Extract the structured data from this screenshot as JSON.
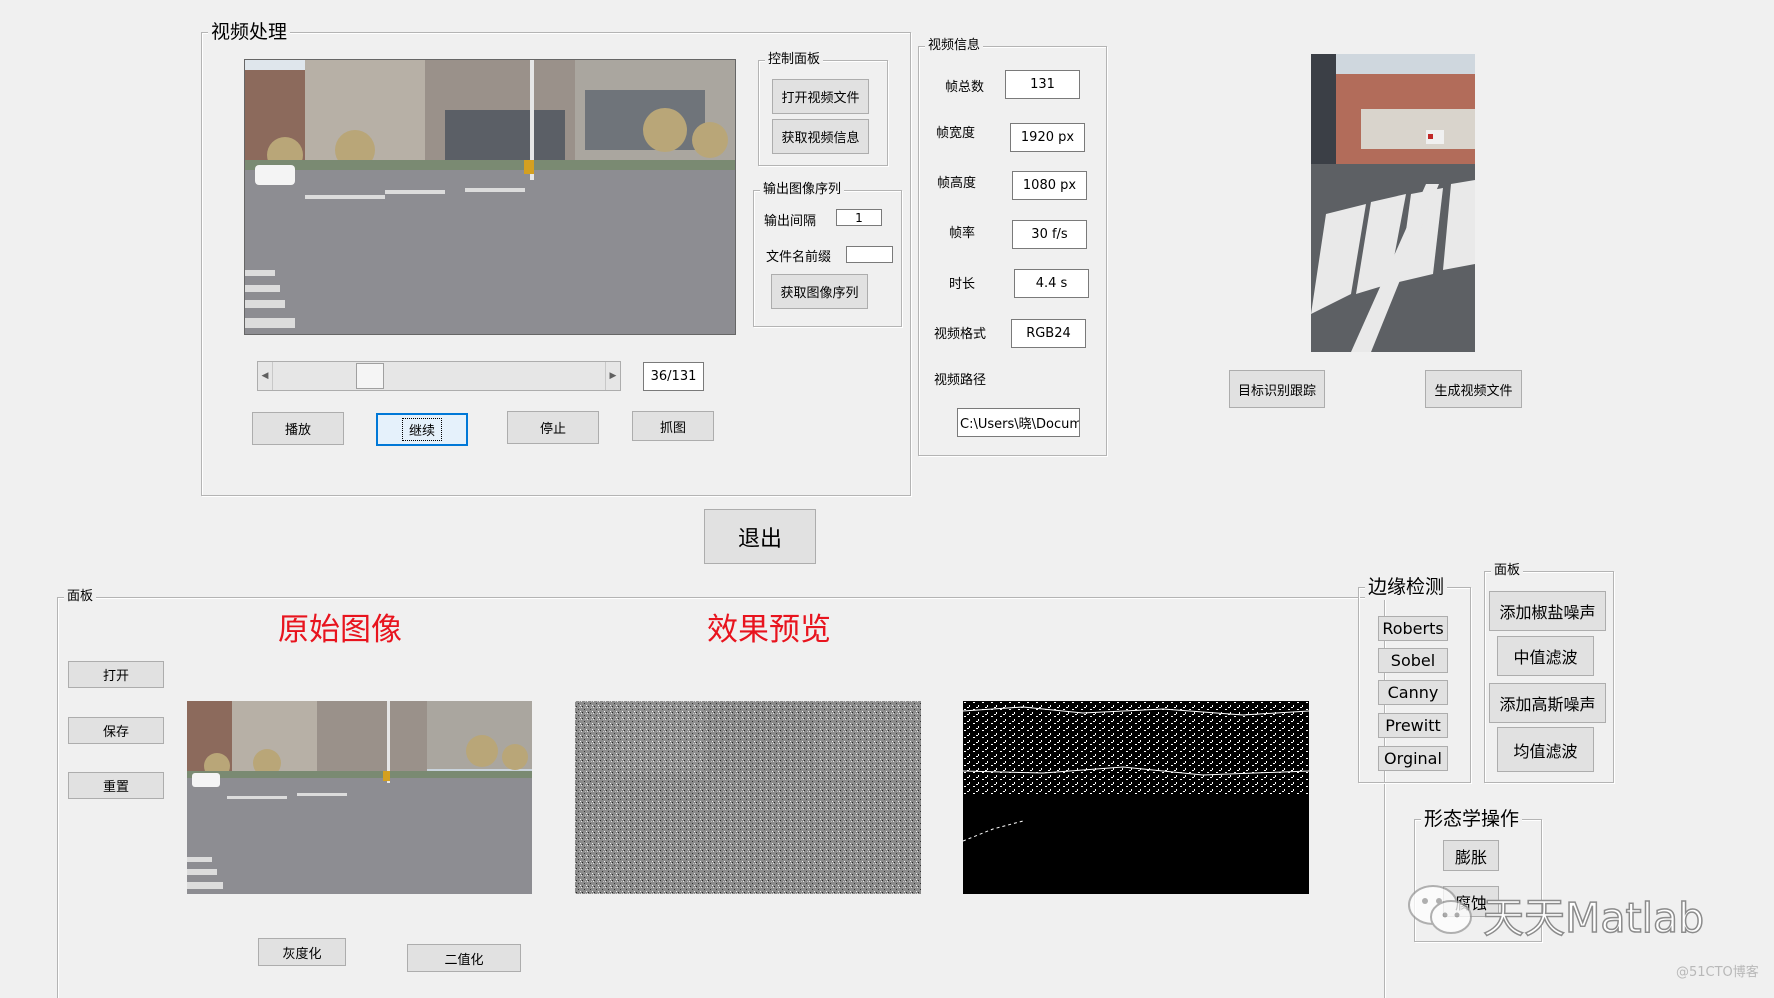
{
  "video_panel": {
    "title": "视频处理",
    "control_panel": {
      "title": "控制面板",
      "open_video_label": "打开视频文件",
      "get_info_label": "获取视频信息"
    },
    "output_sequence": {
      "title": "输出图像序列",
      "interval_label": "输出间隔",
      "interval_value": "1",
      "prefix_label": "文件名前缀",
      "prefix_value": "",
      "get_sequence_label": "获取图像序列"
    },
    "frame_counter": "36/131",
    "slider_fraction": 0.275,
    "buttons": {
      "play": "播放",
      "continue": "继续",
      "stop": "停止",
      "capture": "抓图"
    }
  },
  "video_info": {
    "title": "视频信息",
    "rows": [
      {
        "label": "帧总数",
        "value": "131"
      },
      {
        "label": "帧宽度",
        "value": "1920 px"
      },
      {
        "label": "帧高度",
        "value": "1080 px"
      },
      {
        "label": "帧率",
        "value": "30 f/s"
      },
      {
        "label": "时长",
        "value": "4.4 s"
      },
      {
        "label": "视频格式",
        "value": "RGB24"
      }
    ],
    "path_label": "视频路径",
    "path_value": "C:\\Users\\晓\\Docume"
  },
  "right_top": {
    "track_label": "目标识别跟踪",
    "gen_video_label": "生成视频文件"
  },
  "exit_label": "退出",
  "bottom_panel": {
    "title": "面板",
    "open_label": "打开",
    "save_label": "保存",
    "reset_label": "重置",
    "original_title": "原始图像",
    "preview_title": "效果预览",
    "gray_label": "灰度化",
    "binary_label": "二值化"
  },
  "edge_detection": {
    "title": "边缘检测",
    "items": [
      "Roberts",
      "Sobel",
      "Canny",
      "Prewitt",
      "Orginal"
    ]
  },
  "noise_panel": {
    "title": "面板",
    "items": [
      "添加椒盐噪声",
      "中值滤波",
      "添加高斯噪声",
      "均值滤波"
    ]
  },
  "morphology": {
    "title": "形态学操作",
    "dilate_label": "膨胀",
    "erode_label": "腐蚀"
  },
  "watermark": {
    "brand": "天天Matlab",
    "source": "@51CTO博客"
  },
  "colors": {
    "background": "#f0f0f0",
    "title_red": "#e8141e",
    "focus_blue": "#0078d7"
  }
}
